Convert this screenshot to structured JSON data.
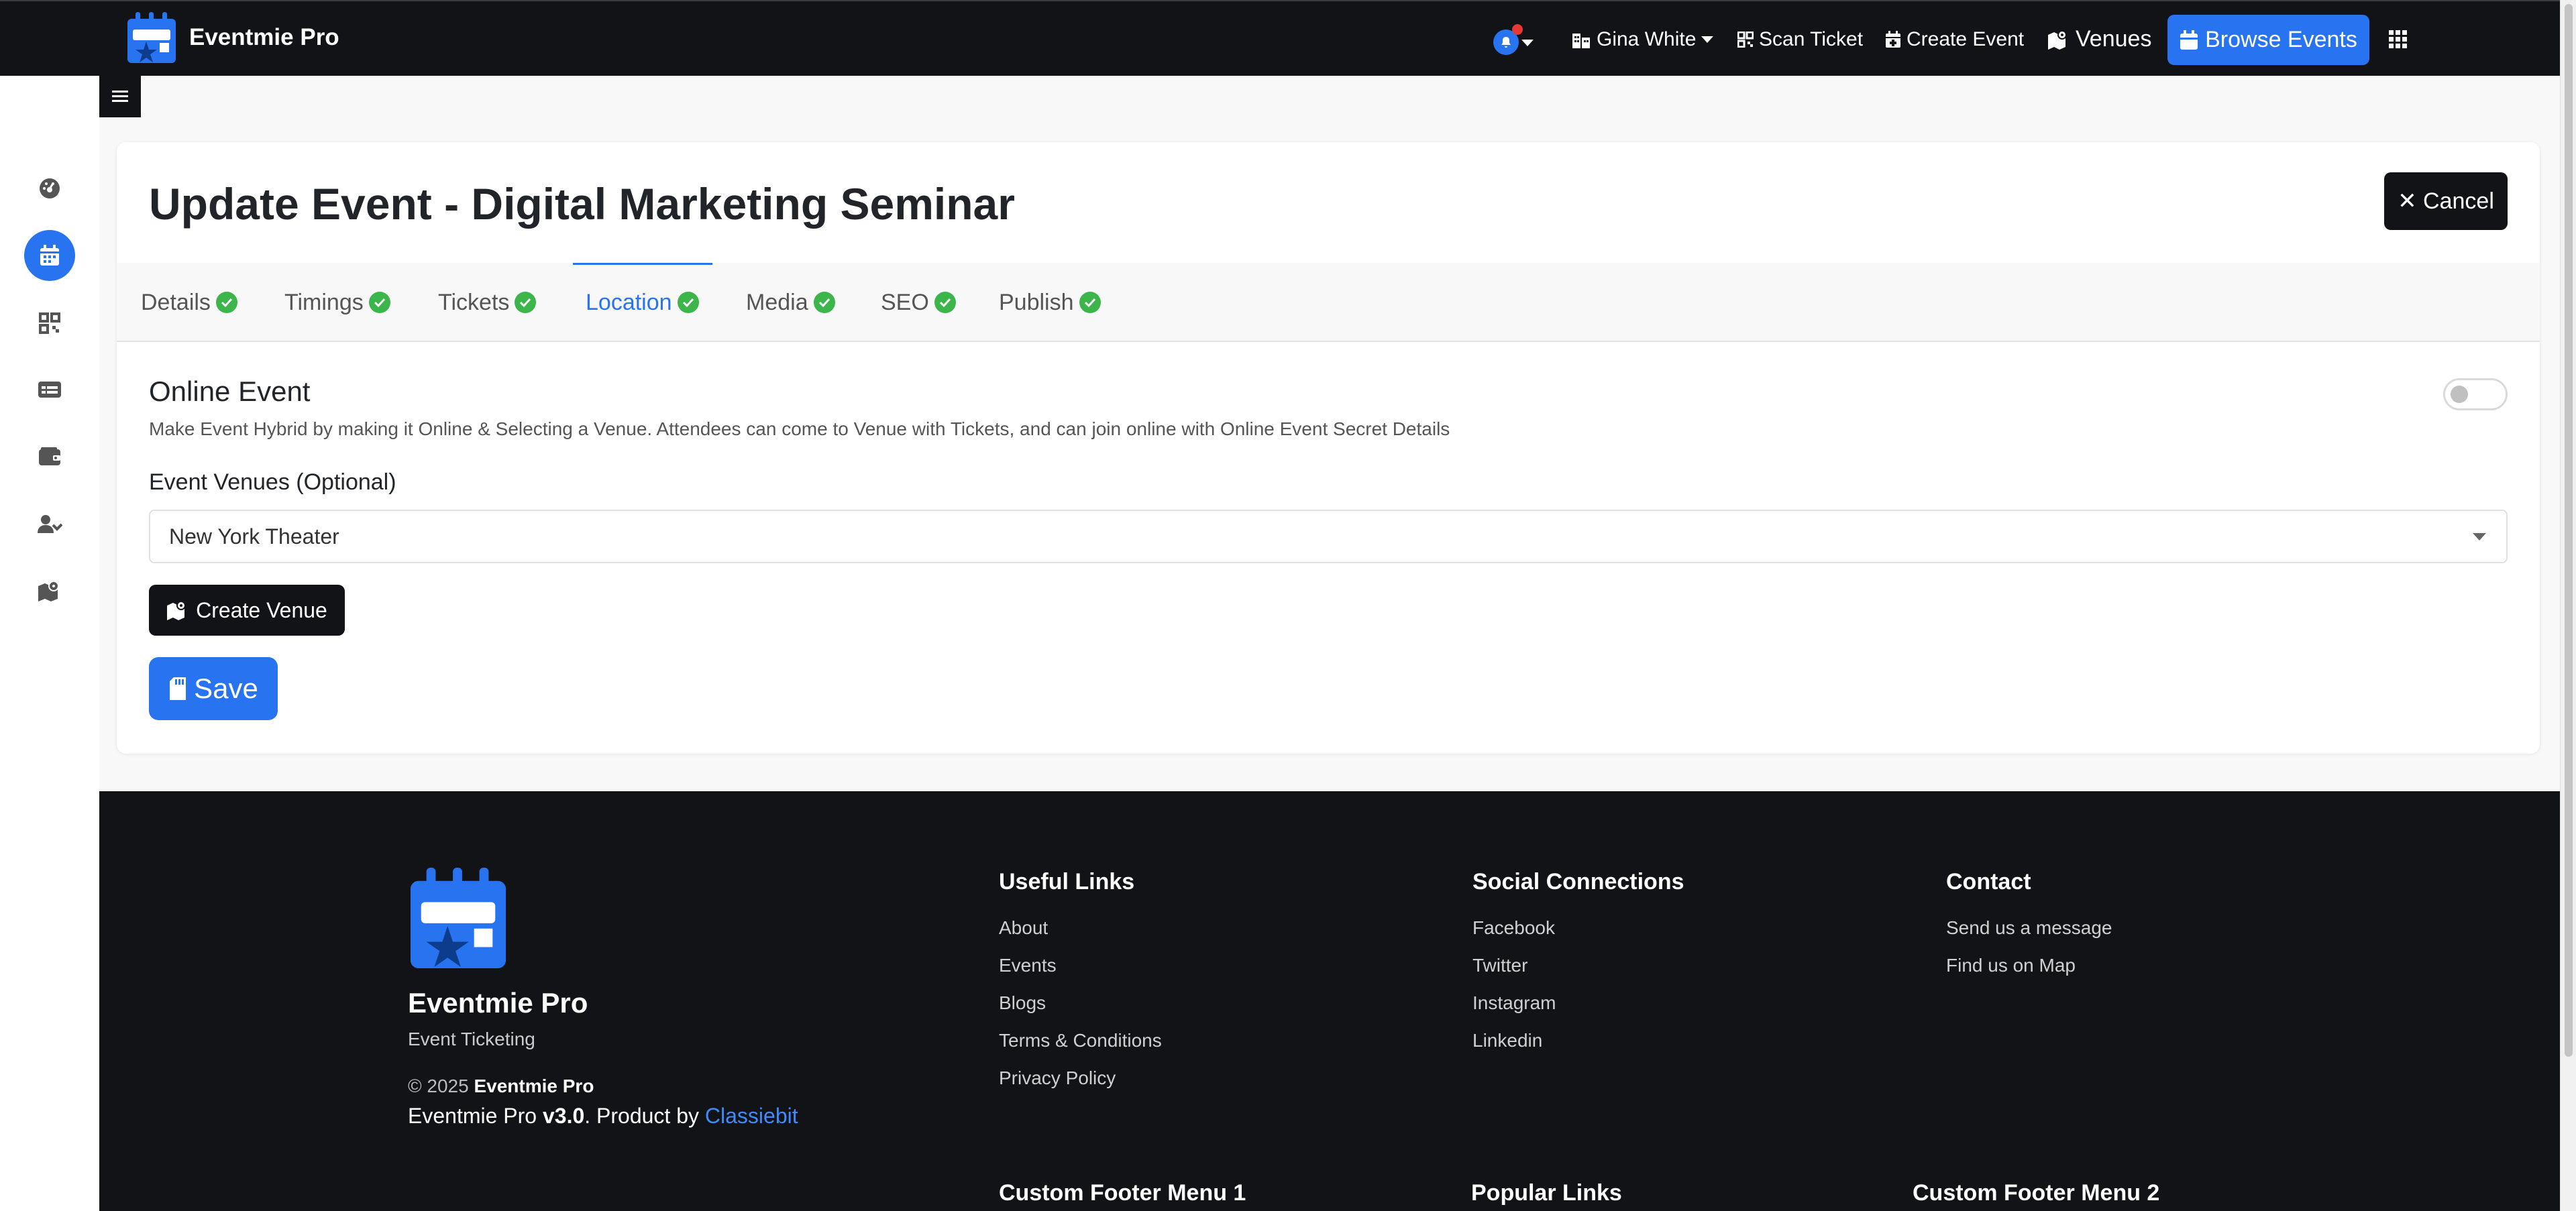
{
  "app": {
    "name": "Eventmie Pro"
  },
  "nav": {
    "user_name": "Gina White",
    "scan_ticket": "Scan Ticket",
    "create_event": "Create Event",
    "venues": "Venues",
    "browse_events": "Browse Events"
  },
  "sidebar": {
    "items": [
      {
        "icon": "dashboard-icon",
        "active": false
      },
      {
        "icon": "calendar-icon",
        "active": true
      },
      {
        "icon": "qrcode-icon",
        "active": false
      },
      {
        "icon": "ticket-icon",
        "active": false
      },
      {
        "icon": "wallet-icon",
        "active": false
      },
      {
        "icon": "users-icon",
        "active": false
      },
      {
        "icon": "map-icon",
        "active": false
      }
    ]
  },
  "page": {
    "title": "Update Event - Digital Marketing Seminar",
    "cancel_label": "✕ Cancel"
  },
  "tabs": [
    {
      "label": "Details",
      "complete": true
    },
    {
      "label": "Timings",
      "complete": true
    },
    {
      "label": "Tickets",
      "complete": true
    },
    {
      "label": "Location",
      "complete": true,
      "active": true
    },
    {
      "label": "Media",
      "complete": true
    },
    {
      "label": "SEO",
      "complete": true
    },
    {
      "label": "Publish",
      "complete": true
    }
  ],
  "form": {
    "online_event_title": "Online Event",
    "online_event_desc": "Make Event Hybrid by making it Online & Selecting a Venue. Attendees can come to Venue with Tickets, and can join online with Online Event Secret Details",
    "online_event_enabled": false,
    "venue_label": "Event Venues (Optional)",
    "venue_value": "New York Theater",
    "create_venue_label": "Create Venue",
    "save_label": "Save"
  },
  "footer": {
    "brand_name": "Eventmie Pro",
    "tagline": "Event Ticketing",
    "copyright_prefix": "© 2025",
    "copyright_name": "Eventmie Pro",
    "version_prefix": "Eventmie Pro",
    "version": "v3.0",
    "version_mid": ". Product by",
    "company": "Classiebit",
    "useful_links": {
      "title": "Useful Links",
      "links": [
        "About",
        "Events",
        "Blogs",
        "Terms & Conditions",
        "Privacy Policy"
      ]
    },
    "social": {
      "title": "Social Connections",
      "links": [
        "Facebook",
        "Twitter",
        "Instagram",
        "Linkedin"
      ]
    },
    "contact": {
      "title": "Contact",
      "links": [
        "Send us a message",
        "Find us on Map"
      ]
    },
    "bottom_titles": [
      "Custom Footer Menu 1",
      "Popular Links",
      "Custom Footer Menu 2"
    ]
  },
  "colors": {
    "primary": "#2874f0",
    "dark": "#121316",
    "success": "#3cb54a"
  }
}
